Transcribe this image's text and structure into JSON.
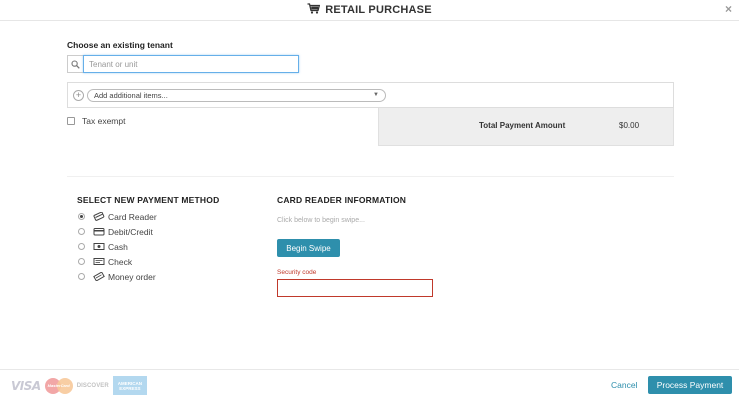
{
  "header": {
    "title": "RETAIL PURCHASE",
    "close_glyph": "×"
  },
  "tenant": {
    "label": "Choose an existing tenant",
    "placeholder": "Tenant or unit",
    "value": ""
  },
  "items": {
    "select_label": "Add additional items...",
    "plus_glyph": "+"
  },
  "tax": {
    "label": "Tax exempt",
    "checked": false
  },
  "totals": {
    "label": "Total Payment Amount",
    "amount": "$0.00"
  },
  "payment_methods": {
    "title": "SELECT NEW PAYMENT METHOD",
    "selected": "Card Reader",
    "options": [
      {
        "label": "Card Reader",
        "icon": "card-reader-icon"
      },
      {
        "label": "Debit/Credit",
        "icon": "credit-card-icon"
      },
      {
        "label": "Cash",
        "icon": "cash-icon"
      },
      {
        "label": "Check",
        "icon": "check-icon"
      },
      {
        "label": "Money order",
        "icon": "money-order-icon"
      }
    ]
  },
  "card_reader": {
    "title": "CARD READER INFORMATION",
    "hint": "Click below to begin swipe...",
    "swipe_label": "Begin Swipe",
    "security_label": "Security code",
    "security_value": ""
  },
  "footer": {
    "cards": {
      "visa": "VISA",
      "mastercard": "MasterCard",
      "discover": "DISCOVER",
      "amex_line1": "AMERICAN",
      "amex_line2": "EXPRESS"
    },
    "cancel_label": "Cancel",
    "process_label": "Process Payment"
  },
  "colors": {
    "accent": "#2e8fac",
    "error": "#c0392b",
    "panel": "#eeeeee"
  }
}
